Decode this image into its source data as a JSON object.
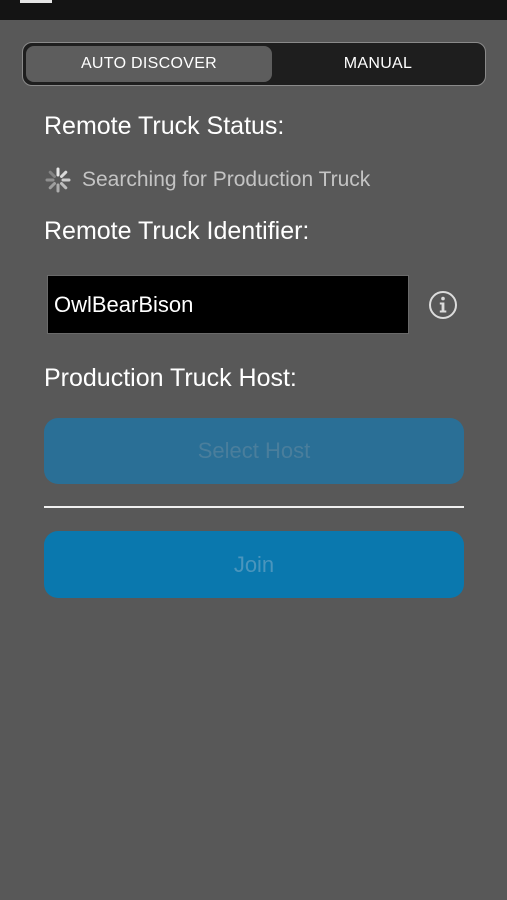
{
  "segmented_control": {
    "auto_label": "AUTO DISCOVER",
    "manual_label": "MANUAL",
    "selected": "AUTO DISCOVER"
  },
  "status": {
    "label": "Remote Truck Status:",
    "text": "Searching for Production Truck"
  },
  "identifier": {
    "label": "Remote Truck Identifier:",
    "value": "OwlBearBison"
  },
  "host": {
    "label": "Production Truck Host:",
    "select_label": "Select Host"
  },
  "join_label": "Join",
  "icons": {
    "menu": "menu-icon",
    "spinner": "spinner-icon",
    "info": "info-icon"
  },
  "colors": {
    "background": "#585858",
    "segment_selected": "#5d5d5d",
    "segment_track": "#1e1e1e",
    "select_host_button": "#2a6f96",
    "join_button": "#0a78ae"
  }
}
